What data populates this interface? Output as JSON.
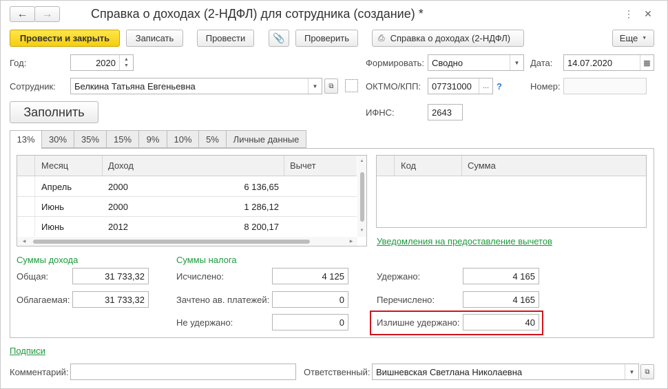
{
  "window": {
    "title": "Справка о доходах (2-НДФЛ) для сотрудника (создание) *"
  },
  "toolbar": {
    "post_close": "Провести и закрыть",
    "save": "Записать",
    "post": "Провести",
    "check": "Проверить",
    "report": "Справка о доходах (2-НДФЛ)",
    "more": "Еще"
  },
  "form": {
    "year_label": "Год:",
    "year": "2020",
    "form_label": "Формировать:",
    "form_value": "Сводно",
    "date_label": "Дата:",
    "date": "14.07.2020",
    "employee_label": "Сотрудник:",
    "employee": "Белкина Татьяна Евгеньевна",
    "oktmo_label": "ОКТМО/КПП:",
    "oktmo": "07731000",
    "oktmo_more": "...",
    "help": "?",
    "number_label": "Номер:",
    "number": "",
    "ifns_label": "ИФНС:",
    "ifns": "2643",
    "fill": "Заполнить"
  },
  "tabs": [
    "13%",
    "30%",
    "35%",
    "15%",
    "9%",
    "10%",
    "5%",
    "Личные данные"
  ],
  "income_table": {
    "headers": [
      "Месяц",
      "Доход",
      "Вычет"
    ],
    "rows": [
      {
        "month": "Апрель",
        "code": "2000",
        "amount": "6 136,65"
      },
      {
        "month": "Июнь",
        "code": "2000",
        "amount": "1 286,12"
      },
      {
        "month": "Июнь",
        "code": "2012",
        "amount": "8 200,17"
      }
    ]
  },
  "deduction_table": {
    "headers": [
      "Код",
      "Сумма"
    ]
  },
  "notifications_link": "Уведомления на предоставление вычетов",
  "income_sums": {
    "title": "Суммы дохода",
    "total_label": "Общая:",
    "total": "31 733,32",
    "taxable_label": "Облагаемая:",
    "taxable": "31 733,32"
  },
  "tax_sums": {
    "title": "Суммы налога",
    "calculated_label": "Исчислено:",
    "calculated": "4 125",
    "offset_label": "Зачтено ав. платежей:",
    "offset": "0",
    "not_withheld_label": "Не удержано:",
    "not_withheld": "0",
    "withheld_label": "Удержано:",
    "withheld": "4 165",
    "transferred_label": "Перечислено:",
    "transferred": "4 165",
    "excess_label": "Излишне удержано:",
    "excess": "40"
  },
  "signatures_link": "Подписи",
  "footer": {
    "comment_label": "Комментарий:",
    "comment": "",
    "responsible_label": "Ответственный:",
    "responsible": "Вишневская Светлана Николаевна"
  },
  "colors": {
    "accent_yellow": "#f6cd10",
    "link_green": "#1d9a3c",
    "highlight_red": "#d0121b"
  }
}
